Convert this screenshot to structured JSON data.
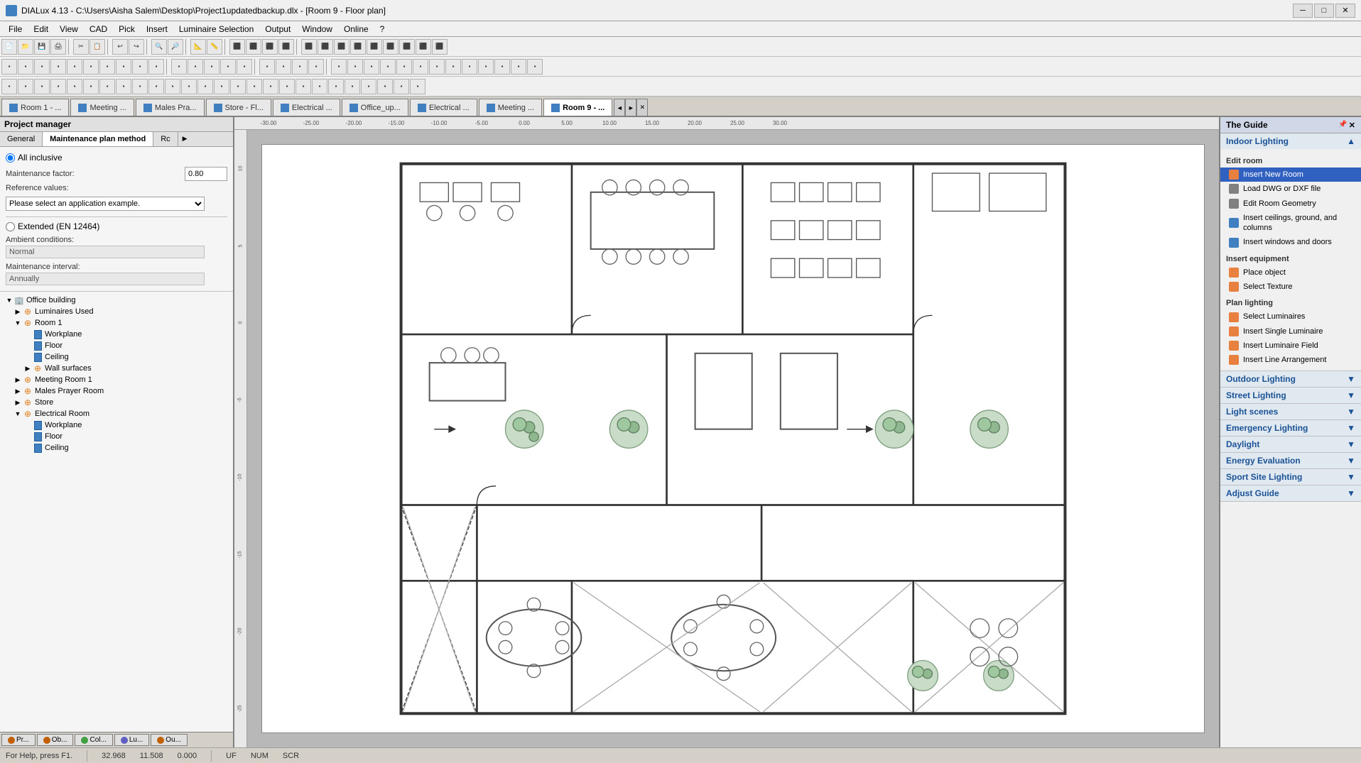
{
  "titleBar": {
    "title": "DIALux 4.13 - C:\\Users\\Aisha Salem\\Desktop\\Project1updatedbackup.dlx - [Room 9 - Floor plan]",
    "appIcon": "dialux-icon",
    "minimize": "─",
    "maximize": "□",
    "close": "✕"
  },
  "menuBar": {
    "items": [
      "File",
      "Edit",
      "View",
      "CAD",
      "Pick",
      "Insert",
      "Luminaire Selection",
      "Output",
      "Window",
      "Online",
      "?"
    ]
  },
  "toolbar1": {
    "buttons": [
      "📄",
      "📁",
      "💾",
      "🖨",
      "✂",
      "📋",
      "↩",
      "↪",
      "🔍",
      "🔍",
      "📐",
      "📏",
      "⬛",
      "⬜",
      "◻",
      "▪",
      "⚙",
      "⚙",
      "⚙",
      "⚙",
      "⚙",
      "⚙",
      "⚙"
    ]
  },
  "toolbar2": {
    "buttons": [
      "⬛",
      "⬛",
      "⬛",
      "⬛",
      "⬛",
      "⬛",
      "⬛",
      "⬛",
      "⬛",
      "⬛",
      "⬛",
      "⬛",
      "⬛",
      "⬛",
      "⬛",
      "⬛",
      "⬛",
      "⬛",
      "⬛",
      "⬛",
      "⬛",
      "⬛"
    ]
  },
  "toolbar3": {
    "buttons": [
      "⬛",
      "⬛",
      "⬛",
      "⬛",
      "⬛",
      "⬛",
      "⬛",
      "⬛",
      "⬛",
      "⬛",
      "⬛",
      "⬛",
      "⬛",
      "⬛"
    ]
  },
  "tabs": [
    {
      "label": "Room 1 - ...",
      "active": false
    },
    {
      "label": "Meeting ...",
      "active": false
    },
    {
      "label": "Males Pra...",
      "active": false
    },
    {
      "label": "Store - Fl...",
      "active": false
    },
    {
      "label": "Electrical ...",
      "active": false
    },
    {
      "label": "Office_up...",
      "active": false
    },
    {
      "label": "Electrical ...",
      "active": false
    },
    {
      "label": "Meeting ...",
      "active": false
    },
    {
      "label": "Room 9 - ...",
      "active": true
    }
  ],
  "leftPanel": {
    "header": "Project manager",
    "tabs": [
      {
        "label": "General",
        "active": false
      },
      {
        "label": "Maintenance plan method",
        "active": true
      },
      {
        "label": "Rc",
        "active": false
      }
    ],
    "maintenance": {
      "allInclusive": "All inclusive",
      "maintenanceFactor": {
        "label": "Maintenance factor:",
        "value": "0.80"
      },
      "referenceValues": {
        "label": "Reference values:",
        "placeholder": "Please select an application example."
      },
      "extended": "Extended (EN 12464)",
      "ambientConditions": {
        "label": "Ambient conditions:",
        "value": "Normal"
      },
      "maintenanceInterval": {
        "label": "Maintenance interval:",
        "value": "Annually"
      }
    },
    "tree": {
      "items": [
        {
          "level": 0,
          "type": "folder",
          "label": "Office building",
          "expanded": true
        },
        {
          "level": 1,
          "type": "folder-orange",
          "label": "Luminaires Used",
          "expanded": false
        },
        {
          "level": 1,
          "type": "folder-orange",
          "label": "Room 1",
          "expanded": true
        },
        {
          "level": 2,
          "type": "page-blue",
          "label": "Workplane"
        },
        {
          "level": 2,
          "type": "page-blue",
          "label": "Floor"
        },
        {
          "level": 2,
          "type": "page-blue",
          "label": "Ceiling"
        },
        {
          "level": 2,
          "type": "folder-orange",
          "label": "Wall surfaces",
          "expanded": false
        },
        {
          "level": 1,
          "type": "folder-orange",
          "label": "Meeting Room 1",
          "expanded": false
        },
        {
          "level": 1,
          "type": "folder-orange",
          "label": "Males Prayer Room",
          "expanded": false
        },
        {
          "level": 1,
          "type": "folder-orange",
          "label": "Store",
          "expanded": false
        },
        {
          "level": 1,
          "type": "folder-orange",
          "label": "Electrical Room",
          "expanded": true
        },
        {
          "level": 2,
          "type": "page-blue",
          "label": "Workplane"
        },
        {
          "level": 2,
          "type": "page-blue",
          "label": "Floor"
        },
        {
          "level": 2,
          "type": "page-blue",
          "label": "Ceiling"
        }
      ]
    },
    "bottomTabs": [
      {
        "label": "Pr...",
        "color": "#c06000"
      },
      {
        "label": "Ob...",
        "color": "#c06000"
      },
      {
        "label": "Col...",
        "color": "#40a040"
      },
      {
        "label": "Lu...",
        "color": "#6060c0"
      },
      {
        "label": "Ou...",
        "color": "#c06000"
      }
    ]
  },
  "ruler": {
    "topMarks": [
      "-30.00",
      "-25.00",
      "-20.00",
      "-15.00",
      "-10.00",
      "-5.00",
      "0.00",
      "5.00",
      "10.00",
      "15.00",
      "20.00",
      "25.00",
      "30.00"
    ],
    "leftMarks": [
      "10.00",
      "5.00",
      "0.00",
      "-5.00",
      "-10.00",
      "-15.00",
      "-20.00",
      "-25.00"
    ]
  },
  "guide": {
    "title": "The Guide",
    "sections": [
      {
        "id": "indoor-lighting",
        "label": "Indoor Lighting",
        "expanded": true,
        "subsections": [
          {
            "label": "Edit room",
            "items": [
              {
                "label": "Insert New Room",
                "icon": "orange",
                "active": true
              },
              {
                "label": "Load DWG or DXF file",
                "icon": "gray"
              },
              {
                "label": "Edit Room Geometry",
                "icon": "gray"
              },
              {
                "label": "Insert ceilings, ground, and columns",
                "icon": "blue"
              },
              {
                "label": "Insert windows and doors",
                "icon": "blue"
              }
            ]
          },
          {
            "label": "Insert equipment",
            "items": [
              {
                "label": "Place object",
                "icon": "orange"
              },
              {
                "label": "Select Texture",
                "icon": "orange"
              }
            ]
          },
          {
            "label": "Plan lighting",
            "items": [
              {
                "label": "Select Luminaires",
                "icon": "orange"
              },
              {
                "label": "Insert Single Luminaire",
                "icon": "orange"
              },
              {
                "label": "Insert Luminaire Field",
                "icon": "orange"
              },
              {
                "label": "Insert Line Arrangement",
                "icon": "orange"
              }
            ]
          }
        ]
      },
      {
        "id": "outdoor-lighting",
        "label": "Outdoor Lighting",
        "expanded": false
      },
      {
        "id": "street-lighting",
        "label": "Street Lighting",
        "expanded": false
      },
      {
        "id": "light-scenes",
        "label": "Light scenes",
        "expanded": false
      },
      {
        "id": "emergency-lighting",
        "label": "Emergency Lighting",
        "expanded": false
      },
      {
        "id": "daylight",
        "label": "Daylight",
        "expanded": false
      },
      {
        "id": "energy-evaluation",
        "label": "Energy Evaluation",
        "expanded": false
      },
      {
        "id": "sport-site-lighting",
        "label": "Sport Site Lighting",
        "expanded": false
      },
      {
        "id": "adjust-guide",
        "label": "Adjust Guide",
        "expanded": false
      }
    ]
  },
  "statusBar": {
    "help": "For Help, press F1.",
    "x": "32.968",
    "y": "11.508",
    "z": "0.000",
    "mode1": "UF",
    "mode2": "NUM",
    "mode3": "SCR"
  }
}
